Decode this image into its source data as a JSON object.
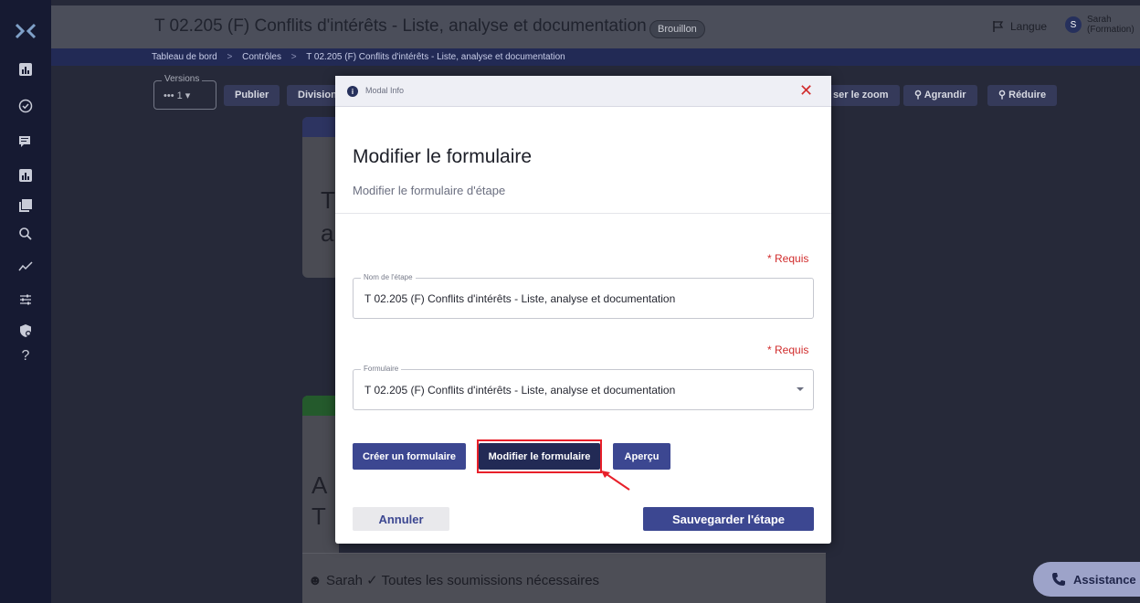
{
  "header": {
    "title": "T 02.205 (F) Conflits d'intérêts - Liste, analyse et documentation",
    "status_badge": "Brouillon",
    "language_label": "Langue",
    "user_initial": "S",
    "user_name_line1": "Sarah",
    "user_name_line2": "(Formation)"
  },
  "breadcrumb": {
    "items": [
      "Tableau de bord",
      "Contrôles",
      "T 02.205 (F) Conflits d'intérêts - Liste, analyse et documentation"
    ],
    "separator": ">"
  },
  "toolbar": {
    "versions_label": "Versions",
    "versions_value": "••• 1 ▾",
    "publish": "Publier",
    "division": "Division",
    "reset_zoom": "ser le zoom",
    "zoom_in": "Agrandir",
    "zoom_out": "Réduire"
  },
  "background": {
    "card1_big_line1": "T",
    "card1_big_line2": "a",
    "card2_big_line1": "A",
    "card2_big_line2": "T",
    "footer_text": "Sarah  ✓ Toutes les soumissions nécessaires"
  },
  "assistance": {
    "label": "Assistance"
  },
  "modal": {
    "header_label": "Modal Info",
    "title": "Modifier le formulaire",
    "subtitle": "Modifier le formulaire d'étape",
    "required_label": "* Requis",
    "step_name": {
      "label": "Nom de l'étape",
      "value": "T 02.205 (F) Conflits d'intérêts - Liste, analyse et documentation"
    },
    "form": {
      "label": "Formulaire",
      "value": "T 02.205 (F) Conflits d'intérêts - Liste, analyse et documentation"
    },
    "buttons": {
      "create": "Créer un formulaire",
      "edit": "Modifier le formulaire",
      "preview": "Aperçu",
      "cancel": "Annuler",
      "save": "Sauvegarder l'étape"
    }
  },
  "colors": {
    "primary": "#3c4791",
    "dark_primary": "#222a55",
    "required": "#d12d2d",
    "highlight": "#e8202a"
  }
}
